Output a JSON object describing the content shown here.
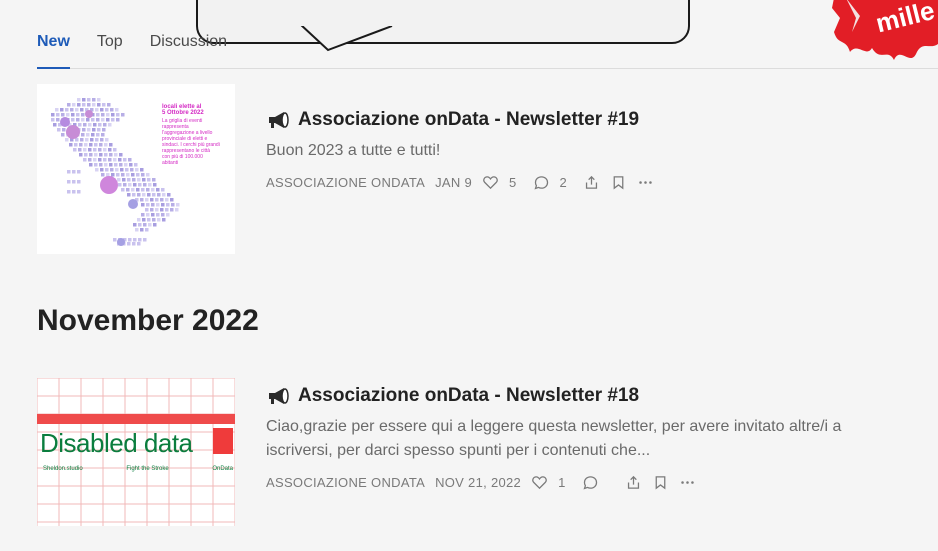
{
  "tabs": [
    {
      "label": "New",
      "active": true
    },
    {
      "label": "Top",
      "active": false
    },
    {
      "label": "Discussion",
      "active": false
    }
  ],
  "logo_text": "mille",
  "section_heading": "November 2022",
  "posts": [
    {
      "title": "Associazione onData - Newsletter #19",
      "subtitle": "Buon 2023 a tutte e tutti!",
      "author": "ASSOCIAZIONE ONDATA",
      "date": "JAN 9",
      "likes": "5",
      "comments": "2",
      "thumb": {
        "lines": [
          "locali elette al",
          "5 Ottobre 2022",
          "La griglia di eventi",
          "rappresenta",
          "l'aggregazione a livello",
          "provinciale di eletti e",
          "sindaci. I cerchi più grandi",
          "rappresentano le città",
          "con più di 100.000",
          "abitanti"
        ]
      }
    },
    {
      "title": "Associazione onData - Newsletter #18",
      "subtitle": "Ciao,grazie per essere qui a leggere questa newsletter, per avere invitato altre/i a iscriversi, per darci spesso spunti per i contenuti che...",
      "author": "ASSOCIAZIONE ONDATA",
      "date": "NOV 21, 2022",
      "likes": "1",
      "comments": "",
      "thumb": {
        "headline": "Disabled data",
        "footer": [
          "Sheldon.studio",
          "Fight the Stroke",
          "OnData"
        ]
      }
    }
  ]
}
